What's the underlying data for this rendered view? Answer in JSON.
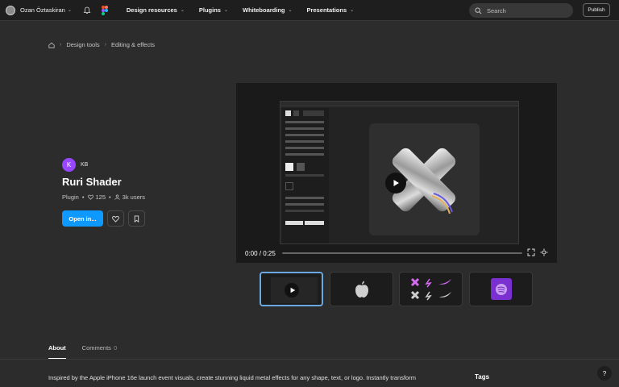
{
  "topbar": {
    "username": "Ozan Öztaskiran",
    "nav": [
      "Design resources",
      "Plugins",
      "Whiteboarding",
      "Presentations"
    ],
    "search_placeholder": "Search",
    "publish_label": "Publish"
  },
  "breadcrumb": [
    "Design tools",
    "Editing & effects"
  ],
  "plugin": {
    "author_initial": "K",
    "author": "KB",
    "title": "Ruri Shader",
    "type": "Plugin",
    "likes": "125",
    "users": "3k users",
    "open_label": "Open in..."
  },
  "video": {
    "time": "0:00 / 0:25",
    "progress": 0
  },
  "thumbnails": [
    "video-preview",
    "apple-logo",
    "nike-logos",
    "spotify-logo"
  ],
  "tabs": [
    {
      "label": "About",
      "count": ""
    },
    {
      "label": "Comments",
      "count": "0"
    }
  ],
  "description": "Inspired by the Apple iPhone 16e launch event visuals, create stunning liquid metal effects for any shape, text, or logo. Instantly transform",
  "sidebar": {
    "tags_heading": "Tags"
  },
  "help_label": "?",
  "colors": {
    "accent": "#0d99ff",
    "background": "#2c2c2c",
    "author": "#9747ff"
  }
}
